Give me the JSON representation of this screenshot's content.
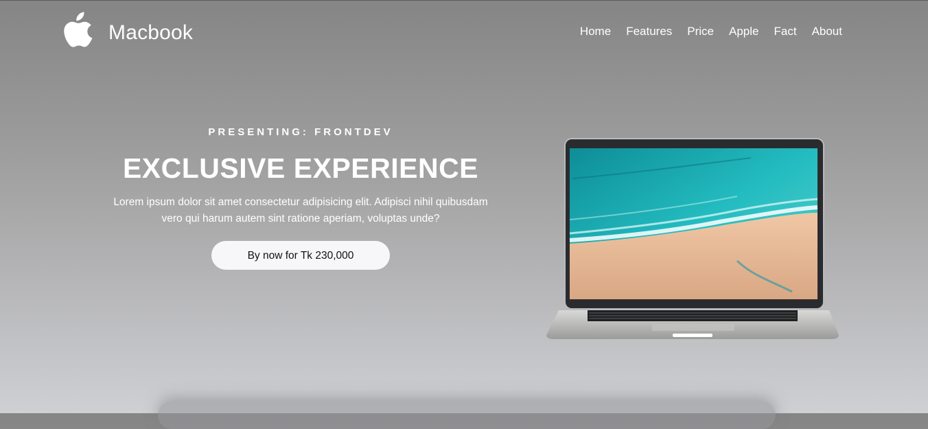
{
  "brand": {
    "logo_icon": "apple-logo-icon",
    "name": "Macbook"
  },
  "nav": {
    "items": [
      {
        "label": "Home"
      },
      {
        "label": "Features"
      },
      {
        "label": "Price"
      },
      {
        "label": "Apple"
      },
      {
        "label": "Fact"
      },
      {
        "label": "About"
      }
    ]
  },
  "hero": {
    "eyebrow": "PRESENTING: FRONTDEV",
    "headline": "EXCLUSIVE EXPERIENCE",
    "description": "Lorem ipsum dolor sit amet consectetur adipisicing elit. Adipisci nihil quibusdam vero qui harum autem sint ratione aperiam, voluptas unde?",
    "cta_label": "By now for Tk 230,000"
  },
  "product_image": {
    "icon": "laptop-image"
  },
  "colors": {
    "background_top": "#858585",
    "background_bottom": "#cfd0d4",
    "text": "#ffffff",
    "button_bg": "#f7f7f9",
    "button_text": "#111111",
    "ocean": "#1fb3b8",
    "sand": "#e8b894"
  }
}
